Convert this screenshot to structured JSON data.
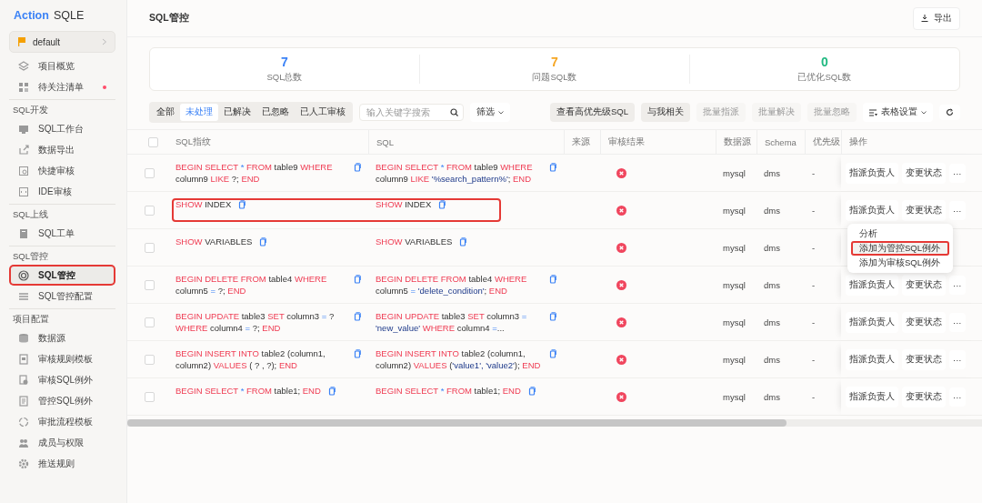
{
  "sidebar": {
    "logo": {
      "brand": "Action",
      "product": "SQLE"
    },
    "project": "default",
    "groups": [
      {
        "items": [
          {
            "label": "项目概览",
            "selected": false,
            "highlighted": false,
            "badge": false
          },
          {
            "label": "待关注清单",
            "selected": false,
            "highlighted": false,
            "badge": true
          }
        ]
      },
      {
        "heading": "SQL开发",
        "items": [
          {
            "label": "SQL工作台",
            "selected": false,
            "highlighted": false,
            "badge": false
          },
          {
            "label": "数据导出",
            "selected": false,
            "highlighted": false,
            "badge": false
          },
          {
            "label": "快捷审核",
            "selected": false,
            "highlighted": false,
            "badge": false
          },
          {
            "label": "IDE审核",
            "selected": false,
            "highlighted": false,
            "badge": false
          }
        ]
      },
      {
        "heading": "SQL上线",
        "items": [
          {
            "label": "SQL工单",
            "selected": false,
            "highlighted": false,
            "badge": false
          }
        ]
      },
      {
        "heading": "SQL管控",
        "items": [
          {
            "label": "SQL管控",
            "selected": true,
            "highlighted": true,
            "badge": false
          },
          {
            "label": "SQL管控配置",
            "selected": false,
            "highlighted": false,
            "badge": false
          }
        ]
      },
      {
        "heading": "项目配置",
        "items": [
          {
            "label": "数据源",
            "selected": false,
            "highlighted": false,
            "badge": false
          },
          {
            "label": "审核规则模板",
            "selected": false,
            "highlighted": false,
            "badge": false
          },
          {
            "label": "审核SQL例外",
            "selected": false,
            "highlighted": false,
            "badge": false
          },
          {
            "label": "管控SQL例外",
            "selected": false,
            "highlighted": false,
            "badge": false
          },
          {
            "label": "审批流程模板",
            "selected": false,
            "highlighted": false,
            "badge": false
          },
          {
            "label": "成员与权限",
            "selected": false,
            "highlighted": false,
            "badge": false
          },
          {
            "label": "推送规则",
            "selected": false,
            "highlighted": false,
            "badge": false
          }
        ]
      }
    ]
  },
  "header": {
    "title": "SQL管控",
    "export_button": "导出"
  },
  "stats": [
    {
      "value": "7",
      "label": "SQL总数",
      "color": "#3b82f6"
    },
    {
      "value": "7",
      "label": "问题SQL数",
      "color": "#f5a623"
    },
    {
      "value": "0",
      "label": "已优化SQL数",
      "color": "#20b981"
    }
  ],
  "filter_tabs": [
    {
      "label": "全部",
      "selected": false
    },
    {
      "label": "未处理",
      "selected": true
    },
    {
      "label": "已解决",
      "selected": false
    },
    {
      "label": "已忽略",
      "selected": false
    },
    {
      "label": "已人工审核",
      "selected": false
    }
  ],
  "search": {
    "placeholder": "输入关键字搜索"
  },
  "filter_button": "筛选",
  "toolbar_buttons": [
    {
      "label": "查看高优先级SQL",
      "disabled": false
    },
    {
      "label": "与我相关",
      "disabled": false
    },
    {
      "label": "批量指派",
      "disabled": true
    },
    {
      "label": "批量解决",
      "disabled": true
    },
    {
      "label": "批量忽略",
      "disabled": true
    }
  ],
  "table_settings": "表格设置",
  "table": {
    "select_all_checked": false,
    "columns": [
      "SQL指纹",
      "SQL",
      "来源",
      "审核结果",
      "数据源",
      "Schema",
      "优先级",
      "操作"
    ],
    "rows": [
      {
        "highlighted": false,
        "fingerprint": [
          {
            "kind": "kw",
            "text": "BEGIN SELECT "
          },
          {
            "kind": "op",
            "text": "* "
          },
          {
            "kind": "kw",
            "text": "FROM "
          },
          {
            "kind": "id",
            "text": "table9 "
          },
          {
            "kind": "kw",
            "text": "WHERE "
          },
          {
            "kind": "id",
            "text": "column9 "
          },
          {
            "kind": "kw",
            "text": "LIKE "
          },
          {
            "kind": "id",
            "text": "?; "
          },
          {
            "kind": "kw",
            "text": "END"
          }
        ],
        "sql": [
          {
            "kind": "kw",
            "text": "BEGIN SELECT "
          },
          {
            "kind": "op",
            "text": "* "
          },
          {
            "kind": "kw",
            "text": "FROM "
          },
          {
            "kind": "id",
            "text": "table9 "
          },
          {
            "kind": "kw",
            "text": "WHERE "
          },
          {
            "kind": "id",
            "text": "column9 "
          },
          {
            "kind": "kw",
            "text": "LIKE "
          },
          {
            "kind": "str",
            "text": "'%search_pattern%'"
          },
          {
            "kind": "id",
            "text": "; "
          },
          {
            "kind": "kw",
            "text": "END"
          }
        ],
        "checked": false,
        "audit_failed": true,
        "datasource": "mysql",
        "schema": "dms",
        "priority": "-",
        "actions": [
          "指派负责人",
          "变更状态",
          "···"
        ]
      },
      {
        "highlighted": true,
        "fingerprint": [
          {
            "kind": "kw",
            "text": "SHOW "
          },
          {
            "kind": "id",
            "text": "INDEX"
          }
        ],
        "sql": [
          {
            "kind": "kw",
            "text": "SHOW "
          },
          {
            "kind": "id",
            "text": "INDEX"
          }
        ],
        "checked": false,
        "audit_failed": true,
        "datasource": "mysql",
        "schema": "dms",
        "priority": "-",
        "actions": [
          "指派负责人",
          "变更状态",
          "···"
        ]
      },
      {
        "highlighted": false,
        "fingerprint": [
          {
            "kind": "kw",
            "text": "SHOW "
          },
          {
            "kind": "id",
            "text": "VARIABLES"
          }
        ],
        "sql": [
          {
            "kind": "kw",
            "text": "SHOW "
          },
          {
            "kind": "id",
            "text": "VARIABLES"
          }
        ],
        "checked": false,
        "audit_failed": true,
        "datasource": "mysql",
        "schema": "dms",
        "priority": "-"
      },
      {
        "highlighted": false,
        "fingerprint": [
          {
            "kind": "kw",
            "text": "BEGIN DELETE FROM "
          },
          {
            "kind": "id",
            "text": "table4 "
          },
          {
            "kind": "kw",
            "text": "WHERE "
          },
          {
            "kind": "id",
            "text": "column5 "
          },
          {
            "kind": "op",
            "text": "= "
          },
          {
            "kind": "id",
            "text": "?; "
          },
          {
            "kind": "kw",
            "text": "END"
          }
        ],
        "sql": [
          {
            "kind": "kw",
            "text": "BEGIN DELETE FROM "
          },
          {
            "kind": "id",
            "text": "table4 "
          },
          {
            "kind": "kw",
            "text": "WHERE "
          },
          {
            "kind": "id",
            "text": "column5 "
          },
          {
            "kind": "op",
            "text": "= "
          },
          {
            "kind": "str",
            "text": "'delete_condition'"
          },
          {
            "kind": "id",
            "text": "; "
          },
          {
            "kind": "kw",
            "text": "END"
          }
        ],
        "checked": false,
        "audit_failed": true,
        "datasource": "mysql",
        "schema": "dms",
        "priority": "-",
        "actions": [
          "指派负责人",
          "变更状态",
          "···"
        ]
      },
      {
        "highlighted": false,
        "fingerprint": [
          {
            "kind": "kw",
            "text": "BEGIN UPDATE "
          },
          {
            "kind": "id",
            "text": "table3 "
          },
          {
            "kind": "kw",
            "text": "SET "
          },
          {
            "kind": "id",
            "text": "column3 "
          },
          {
            "kind": "op",
            "text": "= "
          },
          {
            "kind": "id",
            "text": "? "
          },
          {
            "kind": "kw",
            "text": "WHERE "
          },
          {
            "kind": "id",
            "text": "column4 "
          },
          {
            "kind": "op",
            "text": "= "
          },
          {
            "kind": "id",
            "text": "?; "
          },
          {
            "kind": "kw",
            "text": "END"
          }
        ],
        "sql": [
          {
            "kind": "kw",
            "text": "BEGIN UPDATE "
          },
          {
            "kind": "id",
            "text": "table3 "
          },
          {
            "kind": "kw",
            "text": "SET "
          },
          {
            "kind": "id",
            "text": "column3 "
          },
          {
            "kind": "op",
            "text": "= "
          },
          {
            "kind": "str",
            "text": "'new_value' "
          },
          {
            "kind": "kw",
            "text": "WHERE "
          },
          {
            "kind": "id",
            "text": "column4 "
          },
          {
            "kind": "op",
            "text": "="
          },
          {
            "kind": "id",
            "text": "..."
          }
        ],
        "checked": false,
        "audit_failed": true,
        "datasource": "mysql",
        "schema": "dms",
        "priority": "-",
        "actions": [
          "指派负责人",
          "变更状态",
          "···"
        ]
      },
      {
        "highlighted": false,
        "fingerprint": [
          {
            "kind": "kw",
            "text": "BEGIN INSERT INTO "
          },
          {
            "kind": "id",
            "text": "table2 (column1, column2) "
          },
          {
            "kind": "kw",
            "text": "VALUES "
          },
          {
            "kind": "id",
            "text": "( ? , ?); "
          },
          {
            "kind": "kw",
            "text": "END"
          }
        ],
        "sql": [
          {
            "kind": "kw",
            "text": "BEGIN INSERT INTO "
          },
          {
            "kind": "id",
            "text": "table2 (column1, column2) "
          },
          {
            "kind": "kw",
            "text": "VALUES "
          },
          {
            "kind": "id",
            "text": "("
          },
          {
            "kind": "str",
            "text": "'value1', 'value2'"
          },
          {
            "kind": "id",
            "text": "); "
          },
          {
            "kind": "kw",
            "text": "END"
          }
        ],
        "checked": false,
        "audit_failed": true,
        "datasource": "mysql",
        "schema": "dms",
        "priority": "-",
        "actions": [
          "指派负责人",
          "变更状态",
          "···"
        ]
      },
      {
        "highlighted": false,
        "fingerprint": [
          {
            "kind": "kw",
            "text": "BEGIN SELECT "
          },
          {
            "kind": "op",
            "text": "* "
          },
          {
            "kind": "kw",
            "text": "FROM "
          },
          {
            "kind": "id",
            "text": "table1; "
          },
          {
            "kind": "kw",
            "text": "END"
          }
        ],
        "sql": [
          {
            "kind": "kw",
            "text": "BEGIN SELECT "
          },
          {
            "kind": "op",
            "text": "* "
          },
          {
            "kind": "kw",
            "text": "FROM "
          },
          {
            "kind": "id",
            "text": "table1; "
          },
          {
            "kind": "kw",
            "text": "END"
          }
        ],
        "checked": false,
        "audit_failed": true,
        "datasource": "mysql",
        "schema": "dms",
        "priority": "-",
        "actions": [
          "指派负责人",
          "变更状态",
          "···"
        ]
      }
    ]
  },
  "menu": [
    {
      "label": "分析",
      "highlighted": false
    },
    {
      "label": "添加为管控SQL例外",
      "highlighted": true
    },
    {
      "label": "添加为审核SQL例外",
      "highlighted": false
    }
  ]
}
